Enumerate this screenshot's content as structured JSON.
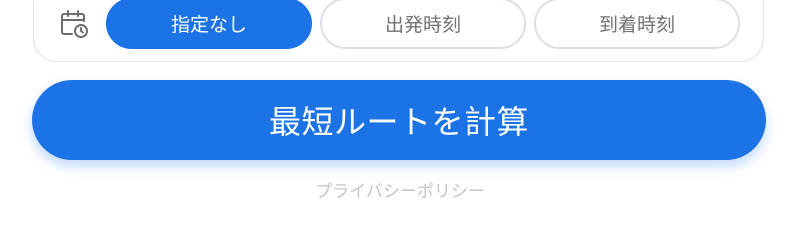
{
  "time_mode": {
    "icon": "calendar-clock-icon",
    "options": [
      {
        "label": "指定なし",
        "selected": true
      },
      {
        "label": "出発時刻",
        "selected": false
      },
      {
        "label": "到着時刻",
        "selected": false
      }
    ]
  },
  "actions": {
    "calculate_label": "最短ルートを計算"
  },
  "footer": {
    "privacy_label": "プライバシーポリシー"
  },
  "colors": {
    "accent": "#1b73e6",
    "inactive_text": "#6f7378",
    "border": "#dcdfe4",
    "link_text": "#c2c5ca"
  }
}
